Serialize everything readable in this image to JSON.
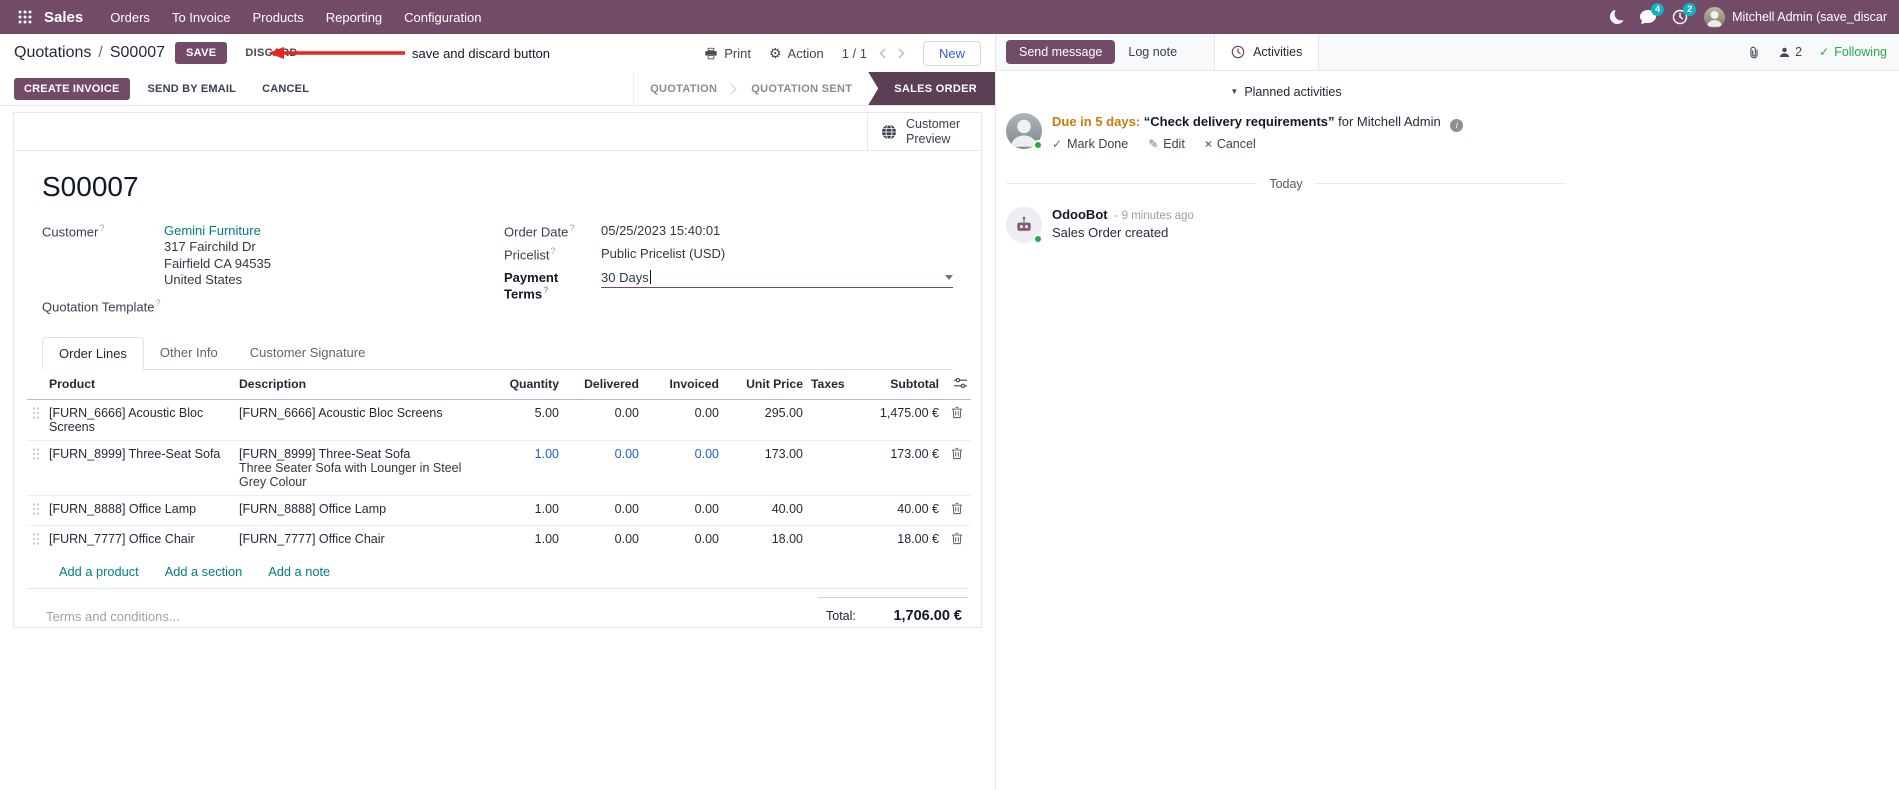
{
  "colors": {
    "accent": "#714B67",
    "link_teal": "#017e84",
    "success_green": "#28a745",
    "due_orange": "#c77d0a",
    "modified_blue": "#1b61b8",
    "annotation_red": "#e8251f",
    "active_stage_bg": "#5d3f55"
  },
  "navbar": {
    "brand": "Sales",
    "menus": [
      "Orders",
      "To Invoice",
      "Products",
      "Reporting",
      "Configuration"
    ],
    "messages_badge": "4",
    "activities_badge": "2",
    "user_name": "Mitchell Admin (save_discar"
  },
  "control_panel": {
    "breadcrumb_parent": "Quotations",
    "breadcrumb_separator": "/",
    "breadcrumb_current": "S00007",
    "save_label": "SAVE",
    "discard_label": "DISCARD",
    "annotation_text": "save and discard button",
    "print_label": "Print",
    "action_label": "Action",
    "pager_value": "1 / 1",
    "new_label": "New"
  },
  "statusbar": {
    "create_invoice_label": "CREATE INVOICE",
    "send_by_email_label": "SEND BY EMAIL",
    "cancel_label": "CANCEL",
    "stages": [
      "QUOTATION",
      "QUOTATION SENT",
      "SALES ORDER"
    ]
  },
  "sheet": {
    "customer_preview_label": "Customer Preview",
    "title": "S00007",
    "help_marker": "?",
    "fields": {
      "customer_label": "Customer",
      "customer_value": "Gemini Furniture",
      "address_line1": "317 Fairchild Dr",
      "address_line2": "Fairfield CA 94535",
      "address_line3": "United States",
      "quotation_template_label": "Quotation Template",
      "order_date_label": "Order Date",
      "order_date_value": "05/25/2023 15:40:01",
      "pricelist_label": "Pricelist",
      "pricelist_value": "Public Pricelist (USD)",
      "payment_terms_label": "Payment Terms",
      "payment_terms_value": "30 Days"
    },
    "tabs": [
      "Order Lines",
      "Other Info",
      "Customer Signature"
    ],
    "order_lines": {
      "headers": {
        "product": "Product",
        "description": "Description",
        "quantity": "Quantity",
        "delivered": "Delivered",
        "invoiced": "Invoiced",
        "unit_price": "Unit Price",
        "taxes": "Taxes",
        "subtotal": "Subtotal"
      },
      "rows": [
        {
          "product": "[FURN_6666] Acoustic Bloc Screens",
          "description": "[FURN_6666] Acoustic Bloc Screens",
          "quantity": "5.00",
          "delivered": "0.00",
          "invoiced": "0.00",
          "unit_price": "295.00",
          "taxes": "",
          "subtotal": "1,475.00 €"
        },
        {
          "product": "[FURN_8999] Three-Seat Sofa",
          "description": "[FURN_8999] Three-Seat Sofa",
          "description_line2": "Three Seater Sofa with Lounger in Steel Grey Colour",
          "quantity": "1.00",
          "delivered": "0.00",
          "invoiced": "0.00",
          "unit_price": "173.00",
          "taxes": "",
          "subtotal": "173.00 €"
        },
        {
          "product": "[FURN_8888] Office Lamp",
          "description": "[FURN_8888] Office Lamp",
          "quantity": "1.00",
          "delivered": "0.00",
          "invoiced": "0.00",
          "unit_price": "40.00",
          "taxes": "",
          "subtotal": "40.00 €"
        },
        {
          "product": "[FURN_7777] Office Chair",
          "description": "[FURN_7777] Office Chair",
          "quantity": "1.00",
          "delivered": "0.00",
          "invoiced": "0.00",
          "unit_price": "18.00",
          "taxes": "",
          "subtotal": "18.00 €"
        }
      ],
      "add_product_label": "Add a product",
      "add_section_label": "Add a section",
      "add_note_label": "Add a note",
      "terms_placeholder": "Terms and conditions...",
      "total_label": "Total:",
      "total_value": "1,706.00 €"
    }
  },
  "chatter": {
    "send_message_label": "Send message",
    "log_note_label": "Log note",
    "activities_label": "Activities",
    "followers_count": "2",
    "following_label": "Following",
    "planned_activities_label": "Planned activities",
    "activity": {
      "due_text": "Due in 5 days:",
      "summary": "“Check delivery requirements”",
      "assignee_text": "for Mitchell Admin",
      "mark_done_label": "Mark Done",
      "edit_label": "Edit",
      "cancel_label": "Cancel"
    },
    "date_divider": "Today",
    "message": {
      "author": "OdooBot",
      "time": "- 9 minutes ago",
      "body": "Sales Order created"
    }
  }
}
